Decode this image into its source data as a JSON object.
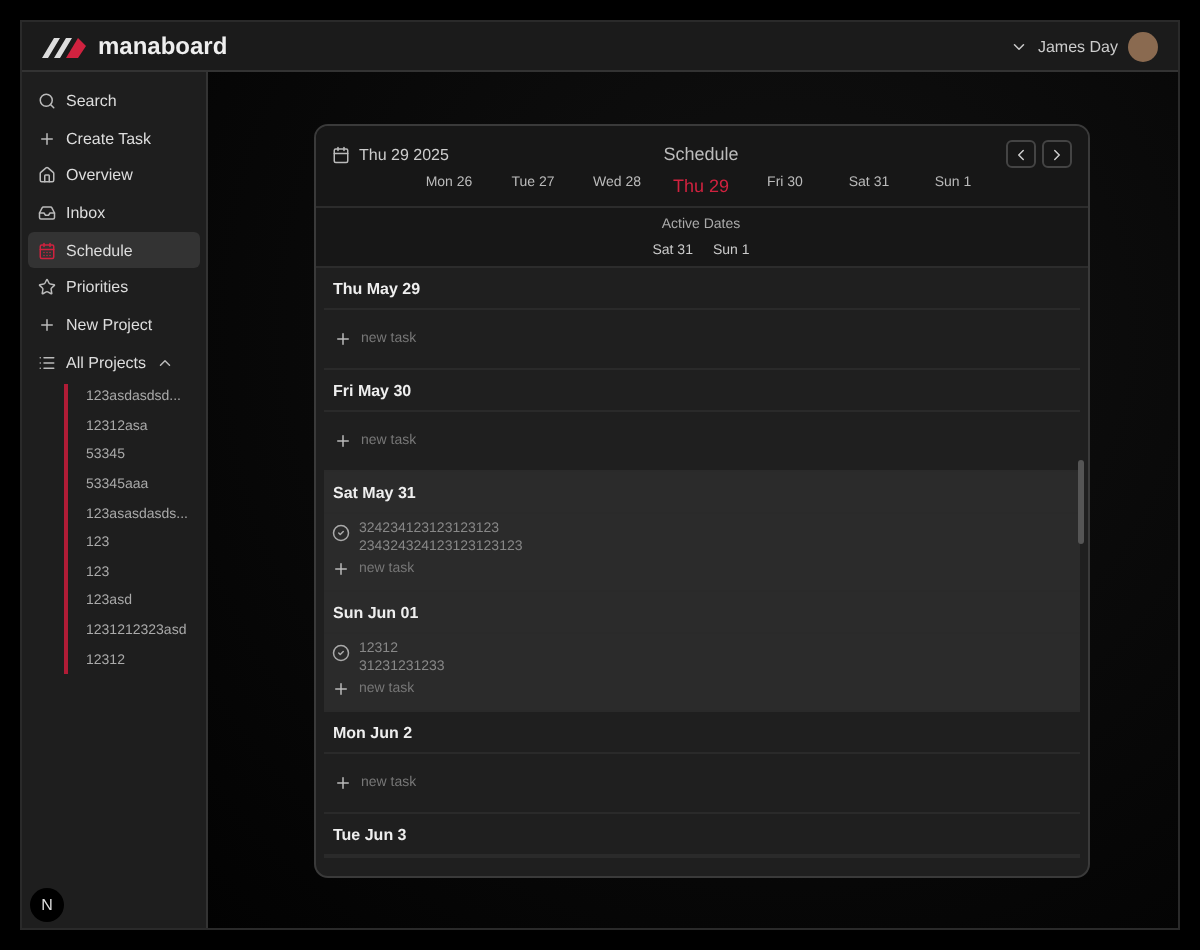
{
  "app": {
    "logo_text": "manaboard",
    "user_name": "James Day"
  },
  "sidebar": {
    "items": [
      {
        "label": "Search",
        "selected": false
      },
      {
        "label": "Create Task",
        "selected": false
      },
      {
        "label": "Overview",
        "selected": false
      },
      {
        "label": "Inbox",
        "selected": false
      },
      {
        "label": "Schedule",
        "selected": true
      },
      {
        "label": "Priorities",
        "selected": false
      },
      {
        "label": "New Project",
        "selected": false
      }
    ],
    "projects": {
      "label": "All Projects",
      "expanded": true,
      "children": [
        "123asdasdsd...",
        "12312asa",
        "53345",
        "53345aaa",
        "123asasdasds...",
        "123",
        "123",
        "123asd",
        "1231212323asd",
        "12312"
      ]
    }
  },
  "schedule": {
    "date": "Thu 29 2025",
    "title": "Schedule",
    "week": [
      {
        "label": "Mon 26",
        "selected": false
      },
      {
        "label": "Tue 27",
        "selected": false
      },
      {
        "label": "Wed 28",
        "selected": false
      },
      {
        "label": "Thu 29",
        "selected": true
      },
      {
        "label": "Fri 30",
        "selected": false
      },
      {
        "label": "Sat 31",
        "selected": false
      },
      {
        "label": "Sun 1",
        "selected": false
      }
    ],
    "active_dates_label": "Active Dates",
    "active_dates": [
      "Sat 31",
      "Sun 1"
    ],
    "days": [
      {
        "title": "Thu May 29",
        "active": false,
        "new_task": "new task"
      },
      {
        "title": "Fri May 30",
        "active": false,
        "new_task": "new task"
      },
      {
        "title": "Sat May 31",
        "active": true,
        "tasks": [
          {
            "title": "324234123123123123",
            "description": "234324324123123123123"
          }
        ],
        "new_task": "new task"
      },
      {
        "title": "Sun Jun 01",
        "active": true,
        "tasks": [
          {
            "title": "12312",
            "description": "31231231233"
          }
        ],
        "new_task": "new task"
      },
      {
        "title": "Mon Jun 2",
        "active": false,
        "new_task": "new task"
      },
      {
        "title": "Tue Jun 3",
        "active": false
      }
    ]
  },
  "dev_badge": "N"
}
